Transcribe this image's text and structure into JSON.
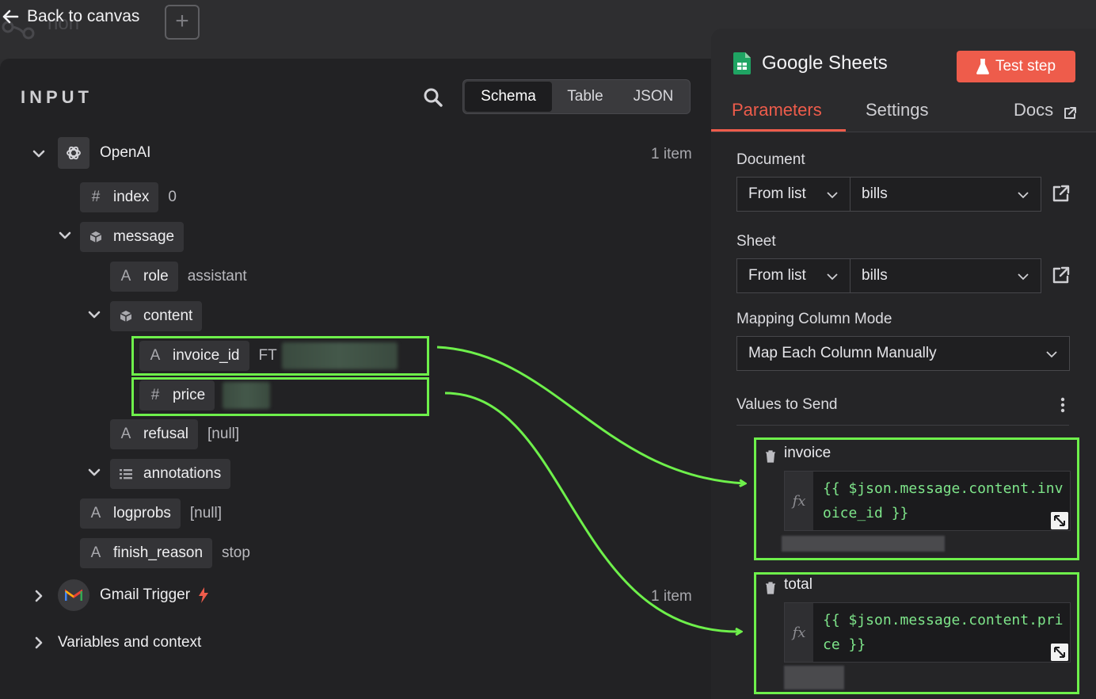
{
  "topbar": {
    "back_label": "Back to canvas",
    "ghost_node_text": "non",
    "add_symbol": "+"
  },
  "input_panel": {
    "title": "INPUT",
    "view_tabs": [
      {
        "label": "Schema",
        "active": true
      },
      {
        "label": "Table",
        "active": false
      },
      {
        "label": "JSON",
        "active": false
      }
    ],
    "nodes": {
      "openai": {
        "name": "OpenAI",
        "count": "1 item"
      },
      "gmail": {
        "name": "Gmail Trigger",
        "count": "1 item"
      },
      "variables": {
        "name": "Variables and context"
      }
    },
    "fields": {
      "index": {
        "type_icon": "#",
        "name": "index",
        "value": "0"
      },
      "message": {
        "name": "message"
      },
      "role": {
        "type_icon": "A",
        "name": "role",
        "value": "assistant"
      },
      "content": {
        "name": "content"
      },
      "invoice_id": {
        "type_icon": "A",
        "name": "invoice_id",
        "value": "FT"
      },
      "price": {
        "type_icon": "#",
        "name": "price"
      },
      "refusal": {
        "type_icon": "A",
        "name": "refusal",
        "value": "[null]"
      },
      "annotations": {
        "name": "annotations"
      },
      "logprobs": {
        "type_icon": "A",
        "name": "logprobs",
        "value": "[null]"
      },
      "finish_reason": {
        "type_icon": "A",
        "name": "finish_reason",
        "value": "stop"
      }
    }
  },
  "params_panel": {
    "node_title": "Google Sheets",
    "test_button": "Test step",
    "tabs": {
      "parameters": "Parameters",
      "settings": "Settings",
      "docs": "Docs"
    },
    "document": {
      "label": "Document",
      "mode": "From list",
      "value": "bills"
    },
    "sheet": {
      "label": "Sheet",
      "mode": "From list",
      "value": "bills"
    },
    "mapping": {
      "label": "Mapping Column Mode",
      "value": "Map Each Column Manually"
    },
    "values_to_send": {
      "label": "Values to Send",
      "fx_label": "fx",
      "items": [
        {
          "name": "invoice",
          "expression": "{{ $json.message.content.invoice_id }}"
        },
        {
          "name": "total",
          "expression": "{{ $json.message.content.price }}"
        }
      ]
    }
  },
  "colors": {
    "accent": "#ee5c4b",
    "highlight": "#6ef04b",
    "expression_text": "#7ee58a",
    "sheets_green": "#1fa463"
  }
}
